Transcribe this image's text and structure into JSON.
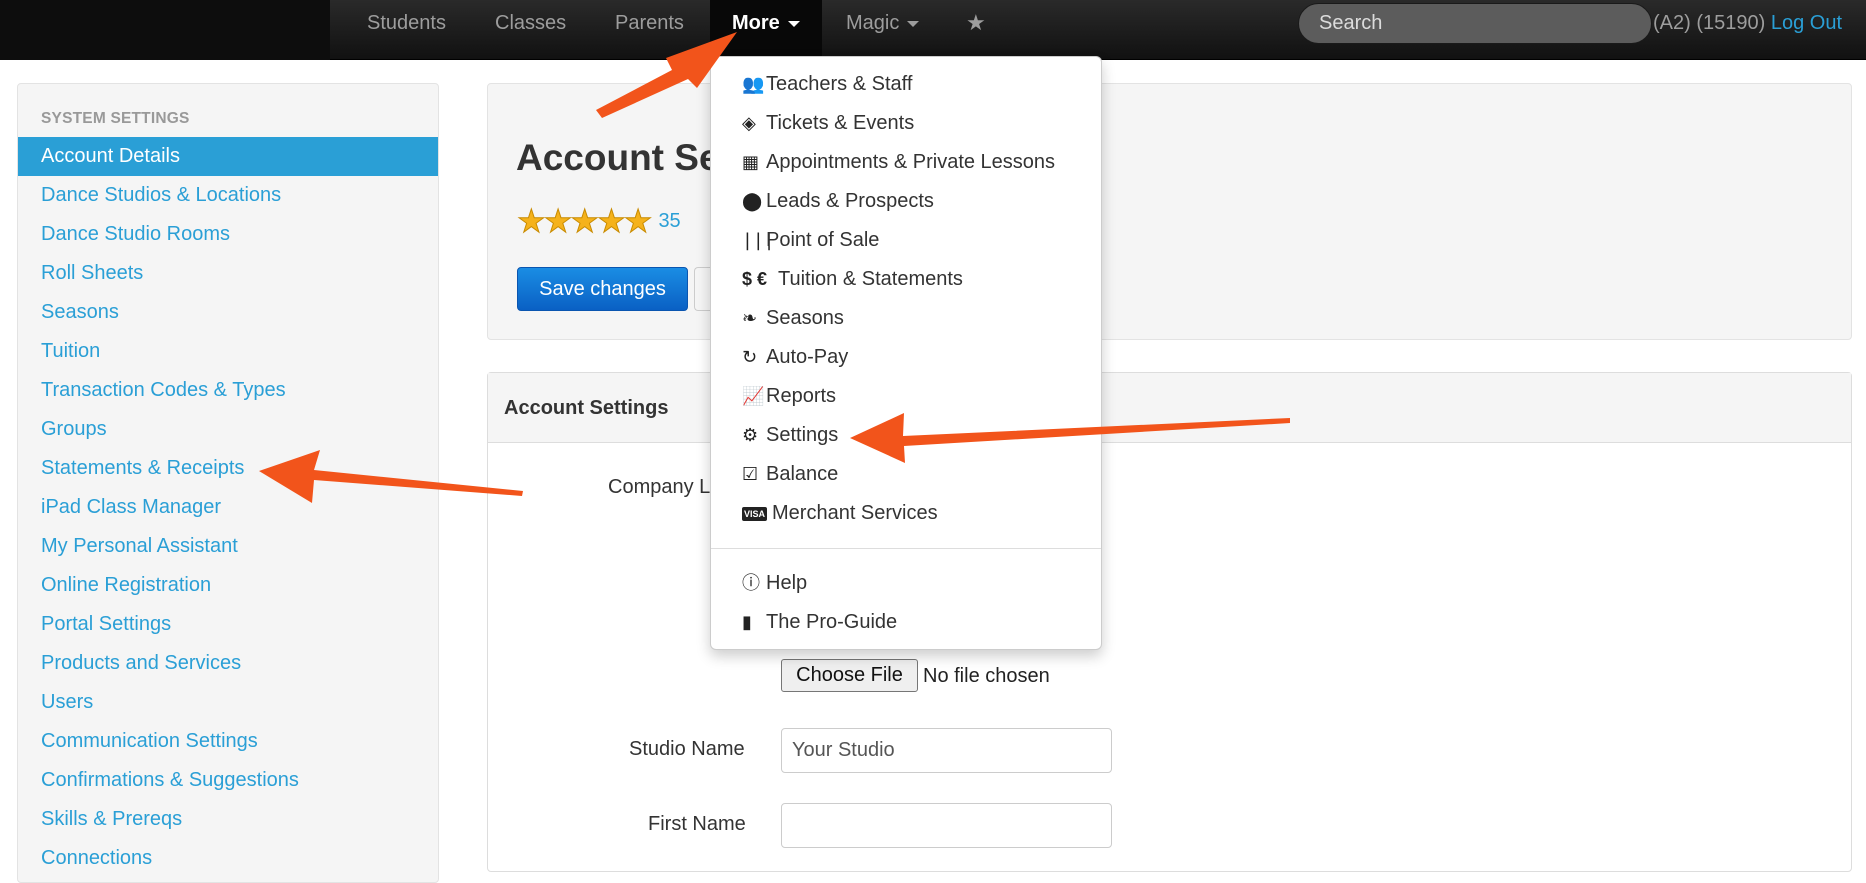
{
  "nav": {
    "items": [
      {
        "label": "Students"
      },
      {
        "label": "Classes"
      },
      {
        "label": "Parents"
      },
      {
        "label": "More"
      },
      {
        "label": "Magic"
      }
    ],
    "favorites_icon": "star-icon",
    "search_placeholder": "Search",
    "user_info": "(A2) (15190)",
    "logout_label": "Log Out"
  },
  "sidebar": {
    "header": "SYSTEM SETTINGS",
    "items": [
      {
        "label": "Account Details"
      },
      {
        "label": "Dance Studios & Locations"
      },
      {
        "label": "Dance Studio Rooms"
      },
      {
        "label": "Roll Sheets"
      },
      {
        "label": "Seasons"
      },
      {
        "label": "Tuition"
      },
      {
        "label": "Transaction Codes & Types"
      },
      {
        "label": "Groups"
      },
      {
        "label": "Statements & Receipts"
      },
      {
        "label": "iPad Class Manager"
      },
      {
        "label": "My Personal Assistant"
      },
      {
        "label": "Online Registration"
      },
      {
        "label": "Portal Settings"
      },
      {
        "label": "Products and Services"
      },
      {
        "label": "Users"
      },
      {
        "label": "Communication Settings"
      },
      {
        "label": "Confirmations & Suggestions"
      },
      {
        "label": "Skills & Prereqs"
      },
      {
        "label": "Connections"
      }
    ]
  },
  "hero": {
    "title": "Account Se",
    "rating_stars": 5,
    "rating_count": "35",
    "save_label": "Save changes"
  },
  "panel": {
    "heading": "Account Settings",
    "company_logo_label": "Company L",
    "choose_file_label": "Choose File",
    "file_status": "No file chosen",
    "studio_name_label": "Studio Name",
    "studio_name_value": "Your Studio",
    "first_name_label": "First Name",
    "first_name_value": ""
  },
  "more_menu": {
    "items": [
      {
        "icon": "users-icon",
        "label": "Teachers & Staff"
      },
      {
        "icon": "ticket-icon",
        "label": "Tickets & Events"
      },
      {
        "icon": "calendar-icon",
        "label": "Appointments & Private Lessons"
      },
      {
        "icon": "map-marker-icon",
        "label": "Leads & Prospects"
      },
      {
        "icon": "barcode-icon",
        "label": "Point of Sale"
      },
      {
        "icon": "dollar-euro-icon",
        "label": "Tuition & Statements"
      },
      {
        "icon": "leaf-icon",
        "label": "Seasons"
      },
      {
        "icon": "refresh-icon",
        "label": "Auto-Pay"
      },
      {
        "icon": "line-chart-icon",
        "label": "Reports"
      },
      {
        "icon": "gears-icon",
        "label": "Settings"
      },
      {
        "icon": "check-square-icon",
        "label": "Balance"
      },
      {
        "icon": "visa-card-icon",
        "label": "Merchant Services"
      }
    ],
    "secondary": [
      {
        "icon": "info-circle-icon",
        "label": "Help"
      },
      {
        "icon": "book-icon",
        "label": "The Pro-Guide"
      }
    ]
  },
  "annotations": {
    "arrow_color": "#f2541b",
    "accent_color": "#2a9fd6"
  }
}
